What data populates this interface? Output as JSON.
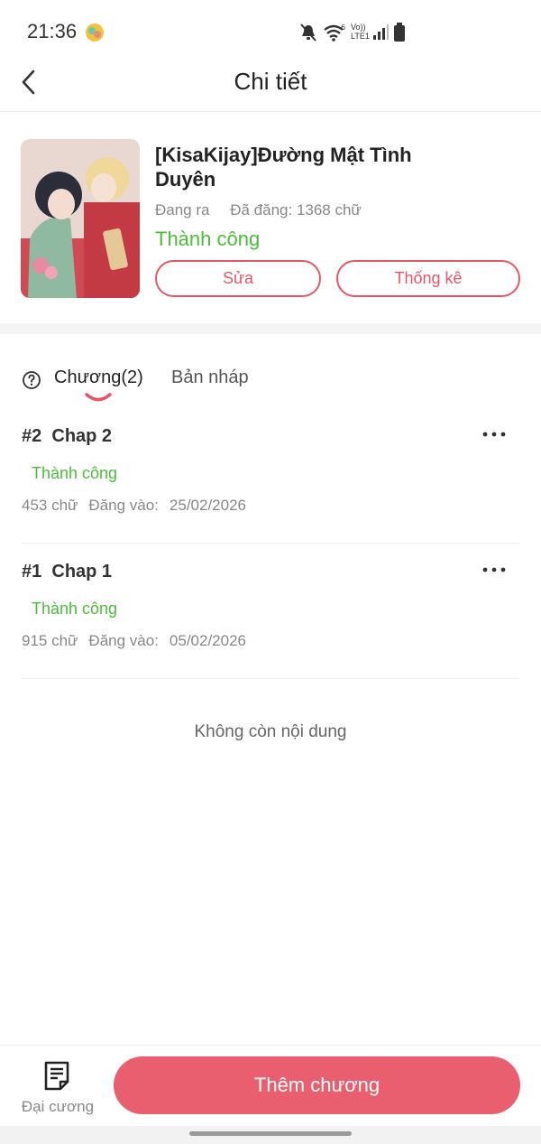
{
  "status_bar": {
    "time": "21:36",
    "network_label_1": "Vo))",
    "network_label_2": "LTE1"
  },
  "header": {
    "title": "Chi tiết"
  },
  "book": {
    "title": "[KisaKijay]Đường Mật Tình Duyên",
    "state": "Đang ra",
    "posted": "Đã đăng: 1368 chữ",
    "status": "Thành công",
    "edit_label": "Sửa",
    "stats_label": "Thống kê"
  },
  "tabs": {
    "chapters": "Chương(2)",
    "drafts": "Bản nháp"
  },
  "chapters": [
    {
      "number": "#2",
      "title": "Chap 2",
      "status": "Thành công",
      "words": "453 chữ",
      "posted_label": "Đăng vào:",
      "date": "25/02/2026"
    },
    {
      "number": "#1",
      "title": "Chap 1",
      "status": "Thành công",
      "words": "915 chữ",
      "posted_label": "Đăng vào:",
      "date": "05/02/2026"
    }
  ],
  "empty_text": "Không còn nội dung",
  "bottom": {
    "outline_label": "Đại cương",
    "add_chapter_label": "Thêm chương"
  },
  "colors": {
    "accent": "#e95f70",
    "success": "#4cbd3a"
  }
}
